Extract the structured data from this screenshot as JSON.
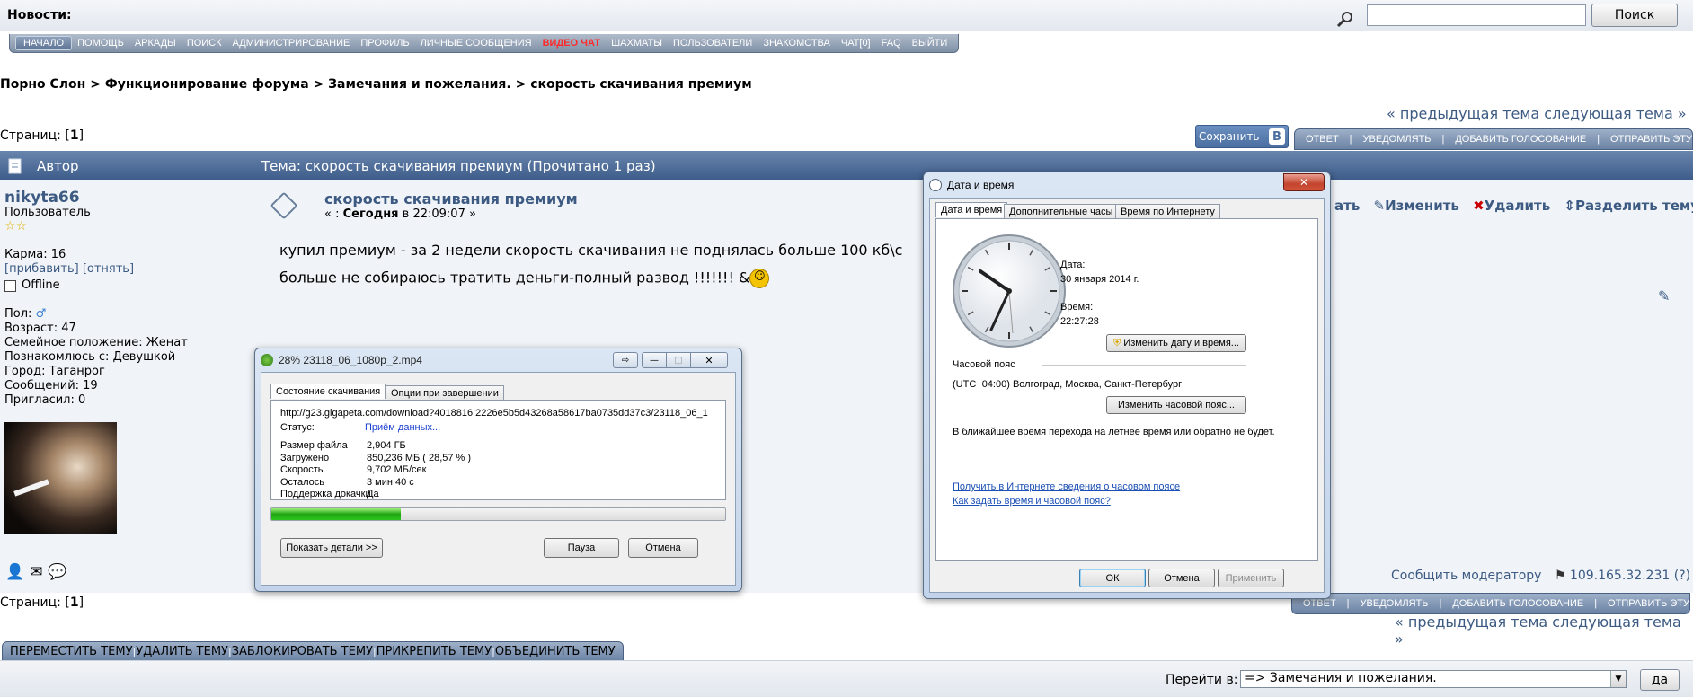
{
  "topbar": {
    "news_label": "Новости:",
    "search_value": "",
    "search_button": "Поиск"
  },
  "nav": [
    "НАЧАЛО",
    "ПОМОЩЬ",
    "АРКАДЫ",
    "ПОИСК",
    "АДМИНИСТРИРОВАНИЕ",
    "ПРОФИЛЬ",
    "ЛИЧНЫЕ СООБЩЕНИЯ",
    "ВИДЕО ЧАТ",
    "ШАХМАТЫ",
    "ПОЛЬЗОВАТЕЛИ",
    "ЗНАКОМСТВА",
    "ЧАТ[0]",
    "FAQ",
    "ВЫЙТИ"
  ],
  "breadcrumb": "Порно Слон > Функционирование форума > Замечания и пожелания. > скорость скачивания премиум",
  "prev_next": "« предыдущая тема следующая тема »",
  "pages_label": "Страниц: [",
  "pages_num": "1",
  "pages_close": "]",
  "save_label": "Сохранить",
  "vk": "B",
  "topic_buttons": [
    "ОТВЕТ",
    "УВЕДОМЛЯТЬ",
    "ДОБАВИТЬ ГОЛОСОВАНИЕ",
    "ОТПРАВИТЬ ЭТУ ТЕМУ"
  ],
  "header": {
    "author": "Автор",
    "topic": "Тема: скорость скачивания премиум  (Прочитано 1 раз)"
  },
  "user": {
    "name": "nikyta66",
    "role": "Пользователь",
    "karma": "Карма: 16",
    "karma_plus": "[прибавить]",
    "karma_minus": "[отнять]",
    "status": "Offline",
    "gender": "Пол:",
    "age": "Возраст: 47",
    "family": "Семейное положение: Женат",
    "meet": "Познакомлюсь с: Девушкой",
    "city": "Город: Таганрог",
    "posts": "Сообщений: 19",
    "invited": "Пригласил: 0"
  },
  "post": {
    "title": "скорость скачивания премиум",
    "date_prefix": "« : ",
    "date_today": "Сегодня",
    "date_time": " в 22:09:07 »",
    "text1": "купил премиум - за 2 недели скорость скачивания не поднялась больше 100 кб\\с",
    "text2": "больше не собираюсь тратить деньги-полный развод   !!!!!!! &",
    "actions_partial": "ать",
    "edit": "Изменить",
    "delete": "Удалить",
    "split": "Разделить тему",
    "report": "Сообщить модератору",
    "ip": "109.165.32.231 (?)"
  },
  "mod_buttons": [
    "ПЕРЕМЕСТИТЬ ТЕМУ",
    "УДАЛИТЬ ТЕМУ",
    "ЗАБЛОКИРОВАТЬ ТЕМУ",
    "ПРИКРЕПИТЬ ТЕМУ",
    "ОБЪЕДИНИТЬ ТЕМУ"
  ],
  "footer": {
    "goto_label": "Перейти в:",
    "goto_value": "=> Замечания и пожелания.",
    "go_button": "да"
  },
  "download": {
    "title": "28% 23118_06_1080p_2.mp4",
    "tab1": "Состояние скачивания",
    "tab2": "Опции при завершении",
    "url": "http://g23.gigapeta.com/download?4018816:2226e5b5d43268a58617ba0735dd37c3/23118_06_1",
    "status_label": "Статус:",
    "status_value": "Приём данных...",
    "rows": [
      {
        "k": "Размер файла",
        "v": "2,904  ГБ"
      },
      {
        "k": "Загружено",
        "v": "850,236  МБ  ( 28,57 % )"
      },
      {
        "k": "Скорость",
        "v": "9,702  МБ/сек"
      },
      {
        "k": "Осталось",
        "v": "3 мин 40 с"
      },
      {
        "k": "Поддержка докачки",
        "v": "Да"
      }
    ],
    "progress": 0.2857,
    "details_btn": "Показать детали >>",
    "pause_btn": "Пауза",
    "cancel_btn": "Отмена"
  },
  "datetime": {
    "title": "Дата и время",
    "tab1": "Дата и время",
    "tab2": "Дополнительные часы",
    "tab3": "Время по Интернету",
    "date_label": "Дата:",
    "date_value": "30 января 2014 г.",
    "time_label": "Время:",
    "time_value": "22:27:28",
    "change_dt_btn": "Изменить дату и время...",
    "tz_label": "Часовой пояс",
    "tz_value": "(UTC+04:00) Волгоград, Москва, Санкт-Петербург",
    "change_tz_btn": "Изменить часовой пояс...",
    "dst_text": "В ближайшее время перехода на летнее время или обратно не будет.",
    "link1": "Получить в Интернете сведения о часовом поясе",
    "link2": "Как задать время и часовой пояс?",
    "ok": "ОК",
    "cancel": "Отмена",
    "apply": "Применить"
  }
}
